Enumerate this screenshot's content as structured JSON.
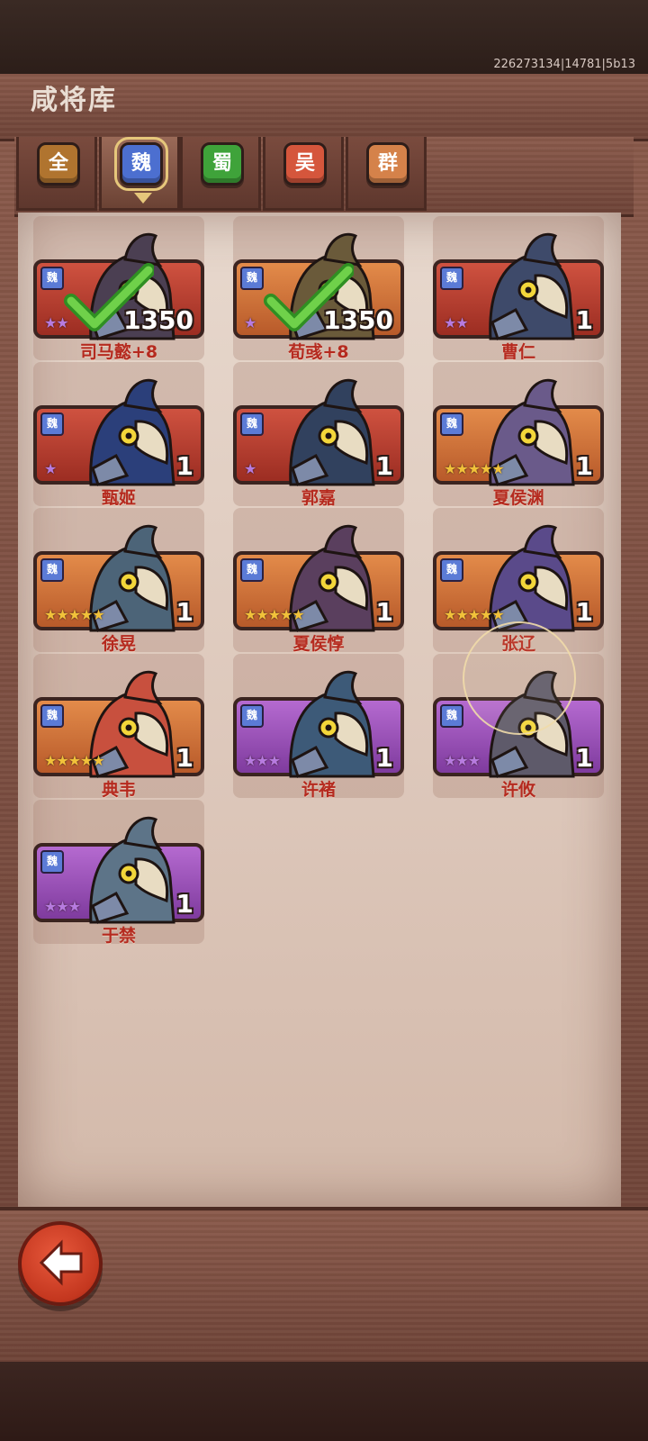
{
  "build_id": "226273134|14781|5b13",
  "title": "咸将库",
  "tabs": [
    {
      "label": "全",
      "color": "#b0742f",
      "active": false
    },
    {
      "label": "魏",
      "color": "#4c6fd0",
      "active": true
    },
    {
      "label": "蜀",
      "color": "#3fa33a",
      "active": false
    },
    {
      "label": "吴",
      "color": "#d5563c",
      "active": false
    },
    {
      "label": "群",
      "color": "#d5824a",
      "active": false
    }
  ],
  "faction_badge": "魏",
  "generals": [
    {
      "name": "司马懿+8",
      "level": "1350",
      "stars": "★★",
      "star_color": "#b77be0",
      "frame": "red",
      "owned_check": true
    },
    {
      "name": "荀彧+8",
      "level": "1350",
      "stars": "★",
      "star_color": "#b77be0",
      "frame": "orange",
      "owned_check": true
    },
    {
      "name": "曹仁",
      "level": "1",
      "stars": "★★",
      "star_color": "#b77be0",
      "frame": "red",
      "owned_check": false
    },
    {
      "name": "甄姬",
      "level": "1",
      "stars": "★",
      "star_color": "#b77be0",
      "frame": "red",
      "owned_check": false
    },
    {
      "name": "郭嘉",
      "level": "1",
      "stars": "★",
      "star_color": "#b77be0",
      "frame": "red",
      "owned_check": false
    },
    {
      "name": "夏侯渊",
      "level": "1",
      "stars": "★★★★★",
      "star_color": "#f2c23a",
      "frame": "orange",
      "owned_check": false
    },
    {
      "name": "徐晃",
      "level": "1",
      "stars": "★★★★★",
      "star_color": "#f2c23a",
      "frame": "orange",
      "owned_check": false
    },
    {
      "name": "夏侯惇",
      "level": "1",
      "stars": "★★★★★",
      "star_color": "#f2c23a",
      "frame": "orange",
      "owned_check": false
    },
    {
      "name": "张辽",
      "level": "1",
      "stars": "★★★★★",
      "star_color": "#f2c23a",
      "frame": "orange",
      "owned_check": false
    },
    {
      "name": "典韦",
      "level": "1",
      "stars": "★★★★★",
      "star_color": "#f2c23a",
      "frame": "orange",
      "owned_check": false
    },
    {
      "name": "许褚",
      "level": "1",
      "stars": "★★★",
      "star_color": "#b77be0",
      "frame": "purple",
      "owned_check": false
    },
    {
      "name": "许攸",
      "level": "1",
      "stars": "★★★",
      "star_color": "#b77be0",
      "frame": "purple",
      "owned_check": false
    },
    {
      "name": "于禁",
      "level": "1",
      "stars": "★★★",
      "star_color": "#b77be0",
      "frame": "purple",
      "owned_check": false
    }
  ]
}
